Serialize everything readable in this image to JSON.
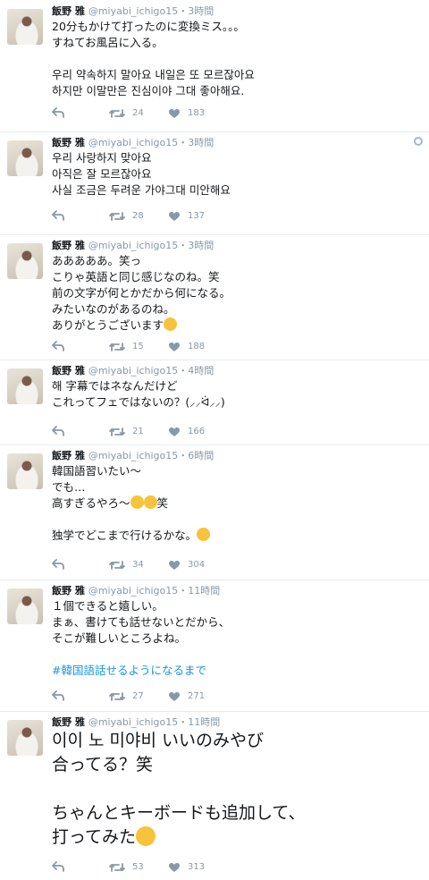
{
  "tweets": [
    {
      "name": "飯野 雅",
      "handle": "@miyabi_ichigo15",
      "time": "3時間",
      "lines": [
        "20分もかけて打ったのに変換ミス。。。",
        "すねてお風呂に入る。",
        "",
        "우리 약속하지 말아요 내일은 또 모르잖아요",
        "하지만 이말만은 진심이야 그대 좋아해요."
      ],
      "retweets": "24",
      "likes": "183"
    },
    {
      "name": "飯野 雅",
      "handle": "@miyabi_ichigo15",
      "time": "3時間",
      "lines": [
        "우리 사랑하지 맞아요",
        "아직은 잘 모르잖아요",
        "사실 조금은 두려운 가야그대 미안해요"
      ],
      "retweets": "28",
      "likes": "137"
    },
    {
      "name": "飯野 雅",
      "handle": "@miyabi_ichigo15",
      "time": "3時間",
      "lines": [
        "あああああ。笑っ",
        "こりゃ英語と同じ感じなのね。笑",
        "前の文字が何とかだから何になる。",
        "みたいなのがあるのね。",
        "ありがとうございます"
      ],
      "retweets": "15",
      "likes": "188"
    },
    {
      "name": "飯野 雅",
      "handle": "@miyabi_ichigo15",
      "time": "4時間",
      "lines": [
        "해 字幕ではネなんだけど",
        "これってフェではないの？(⸝⸝ᐛ⸝⸝)"
      ],
      "retweets": "21",
      "likes": "166"
    },
    {
      "name": "飯野 雅",
      "handle": "@miyabi_ichigo15",
      "time": "6時間",
      "lines": [
        "韓国語習いたい〜",
        "でも…",
        "高すぎるやろ〜",
        "",
        "独学でどこまで行けるかな。"
      ],
      "retweets": "34",
      "likes": "304"
    },
    {
      "name": "飯野 雅",
      "handle": "@miyabi_ichigo15",
      "time": "11時間",
      "lines": [
        "１個できると嬉しい。",
        "まぁ、書けても話せないとだから、",
        "そこが難しいところよね。",
        ""
      ],
      "hashtag": "#韓国語話せるようになるまで",
      "retweets": "27",
      "likes": "271"
    },
    {
      "name": "飯野 雅",
      "handle": "@miyabi_ichigo15",
      "time": "11時間",
      "lines": [
        "이이 노 미야비 いいのみやび",
        "合ってる？笑",
        "",
        "ちゃんとキーボードも追加して、",
        "打ってみた"
      ],
      "retweets": "53",
      "likes": "313"
    }
  ],
  "time_prefix": "・",
  "colors": {
    "accent": "#1b95e0",
    "muted": "#8899a6",
    "divider": "#e6ecf0"
  },
  "icons": {
    "reply": "reply-icon",
    "retweet": "retweet-icon",
    "like": "heart-icon"
  }
}
